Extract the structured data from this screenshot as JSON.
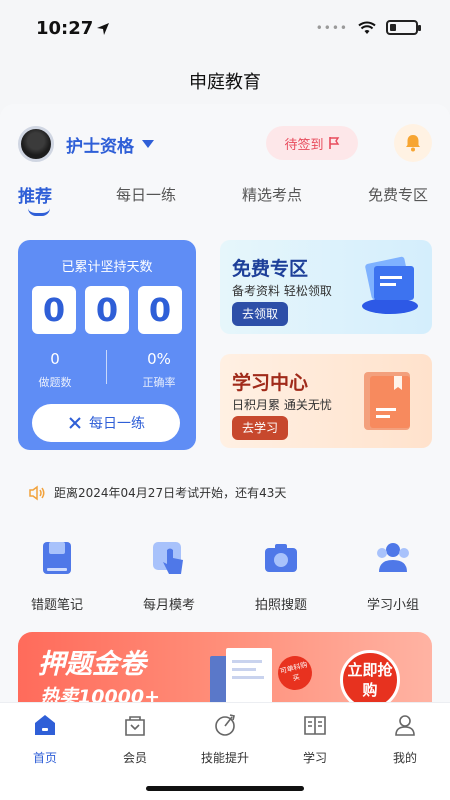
{
  "status_bar": {
    "time": "10:27"
  },
  "nav": {
    "title": "申庭教育"
  },
  "header": {
    "exam_name": "护士资格",
    "checkin_label": "待签到"
  },
  "tabs": [
    {
      "label": "推荐",
      "active": true
    },
    {
      "label": "每日一练",
      "active": false
    },
    {
      "label": "精选考点",
      "active": false
    },
    {
      "label": "免费专区",
      "active": false
    }
  ],
  "stats_card": {
    "title": "已累计坚持天数",
    "days_digits": [
      "0",
      "0",
      "0"
    ],
    "questions_done": "0",
    "questions_done_label": "做题数",
    "accuracy": "0%",
    "accuracy_label": "正确率",
    "daily_button": "每日一练"
  },
  "promos": [
    {
      "title": "免费专区",
      "subtitle": "备考资料 轻松领取",
      "button": "去领取",
      "color": "#1d3f99"
    },
    {
      "title": "学习中心",
      "subtitle": "日积月累 通关无忧",
      "button": "去学习",
      "color": "#a02a1a"
    }
  ],
  "notice": {
    "text": "距离2024年04月27日考试开始，还有43天"
  },
  "features": [
    {
      "label": "错题笔记",
      "icon": "notebook-icon"
    },
    {
      "label": "每月模考",
      "icon": "tap-icon"
    },
    {
      "label": "拍照搜题",
      "icon": "camera-icon"
    },
    {
      "label": "学习小组",
      "icon": "group-icon"
    }
  ],
  "banner": {
    "title": "押题金卷",
    "subtitle": "热卖10000+",
    "sticker": "可单科购买",
    "buy_button": "立即抢购"
  },
  "tabbar": [
    {
      "label": "首页",
      "icon": "home-icon",
      "active": true
    },
    {
      "label": "会员",
      "icon": "member-icon",
      "active": false
    },
    {
      "label": "技能提升",
      "icon": "skill-icon",
      "active": false
    },
    {
      "label": "学习",
      "icon": "study-icon",
      "active": false
    },
    {
      "label": "我的",
      "icon": "profile-icon",
      "active": false
    }
  ],
  "colors": {
    "accent": "#2f5fd7",
    "stats_card": "#5f8df5",
    "banner": "#ff6b5b"
  }
}
